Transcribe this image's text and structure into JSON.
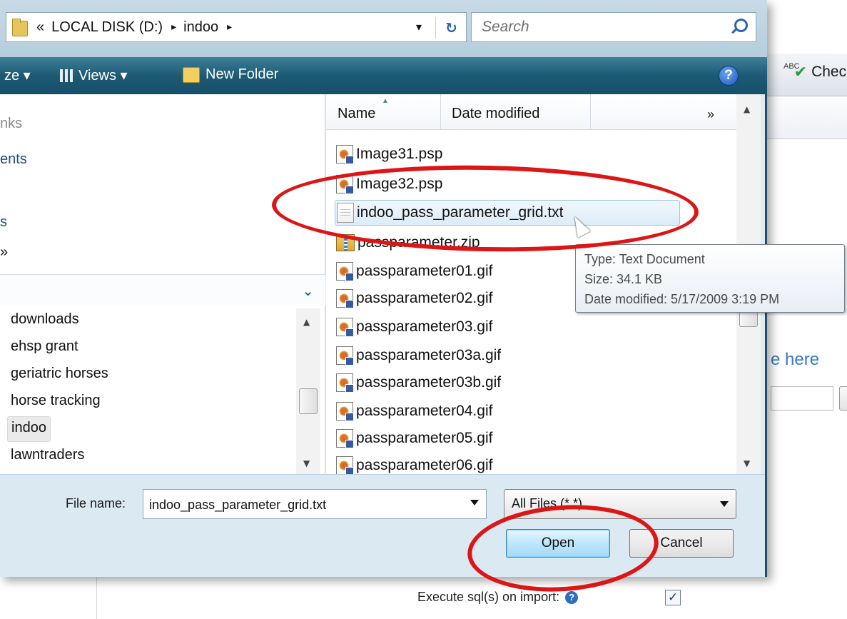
{
  "address": {
    "path_prefix": "«",
    "drive": "LOCAL DISK (D:)",
    "separator1": "▸",
    "folder": "indoo",
    "separator2": "▸",
    "dropdown": "▾",
    "refresh": "↻",
    "search_placeholder": "Search"
  },
  "toolbar": {
    "organize_partial": "ze ▾",
    "views_label": "Views ▾",
    "new_folder_label": "New Folder",
    "help": "?"
  },
  "nav": {
    "links_partial": "nks",
    "documents_partial": "ents",
    "s_partial": "s",
    "more": "»",
    "folders_chevron": "⌄",
    "folders": [
      {
        "label": "downloads"
      },
      {
        "label": "ehsp grant"
      },
      {
        "label": "geriatric horses"
      },
      {
        "label": "horse tracking"
      },
      {
        "label": "indoo"
      },
      {
        "label": "lawntraders"
      }
    ]
  },
  "file_list": {
    "col_name": "Name",
    "col_date": "Date modified",
    "col_more": "»",
    "files": [
      {
        "name": "Image31.psp",
        "icon": "image-file-icon"
      },
      {
        "name": "Image32.psp",
        "icon": "image-file-icon"
      },
      {
        "name": "indoo_pass_parameter_grid.txt",
        "icon": "text-file-icon"
      },
      {
        "name": "passparameter.zip",
        "icon": "zip-file-icon"
      },
      {
        "name": "passparameter01.gif",
        "icon": "image-file-icon"
      },
      {
        "name": "passparameter02.gif",
        "icon": "image-file-icon"
      },
      {
        "name": "passparameter03.gif",
        "icon": "image-file-icon"
      },
      {
        "name": "passparameter03a.gif",
        "icon": "image-file-icon"
      },
      {
        "name": "passparameter03b.gif",
        "icon": "image-file-icon"
      },
      {
        "name": "passparameter04.gif",
        "icon": "image-file-icon"
      },
      {
        "name": "passparameter05.gif",
        "icon": "image-file-icon"
      },
      {
        "name": "passparameter06.gif",
        "icon": "image-file-icon"
      }
    ]
  },
  "tooltip": {
    "type": "Type: Text Document",
    "size": "Size: 34.1 KB",
    "date": "Date modified: 5/17/2009 3:19 PM"
  },
  "bottom": {
    "file_name_label": "File name:",
    "file_name_value": "indoo_pass_parameter_grid.txt",
    "filter_value": "All Files (*.*)",
    "open_label": "Open",
    "cancel_label": "Cancel"
  },
  "background_app": {
    "check_label": "Chec",
    "check_icon_text": "ABC",
    "link_text": "e here",
    "execute_label": "Execute sql(s) on import:",
    "execute_help": "?",
    "execute_checked": "✓"
  },
  "colors": {
    "toolbar": "#1d5a73",
    "annotation": "#dc1616",
    "selection": "#dcecf8"
  }
}
